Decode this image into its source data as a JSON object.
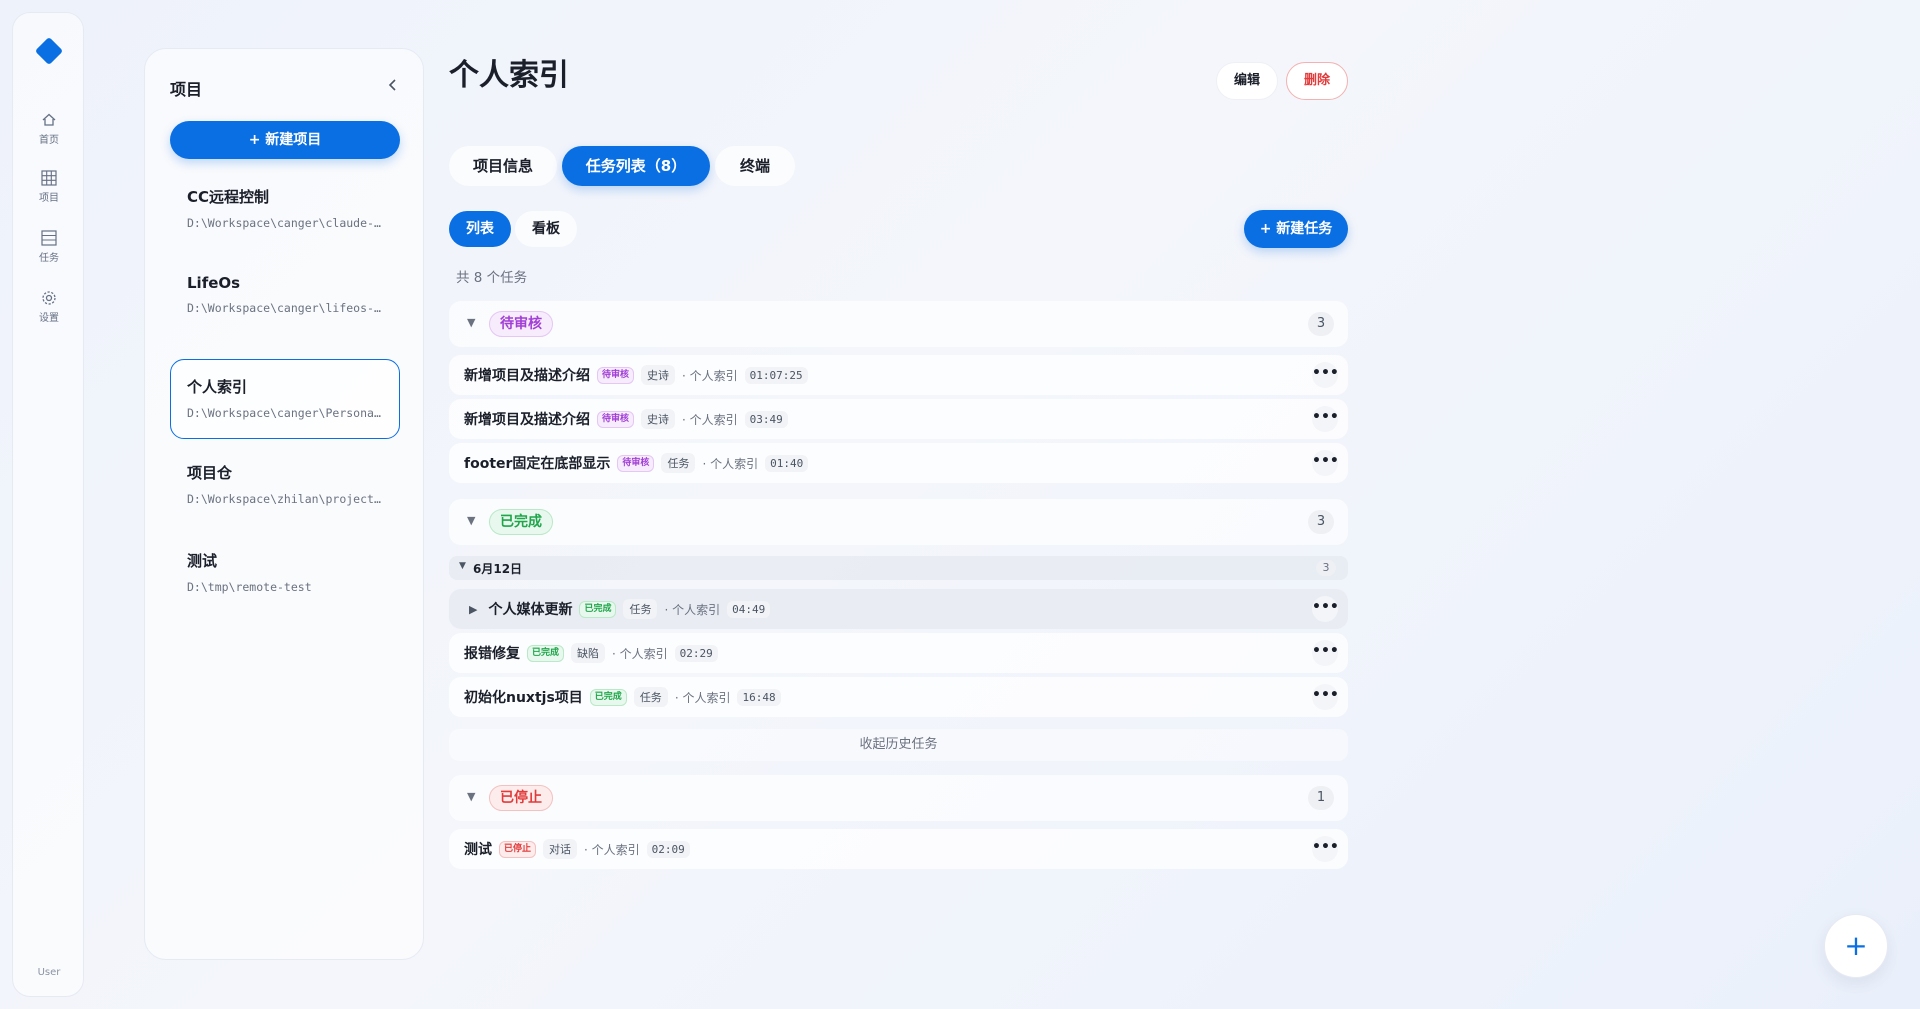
{
  "rail": {
    "items": [
      {
        "label": "首页",
        "icon": "home-icon"
      },
      {
        "label": "项目",
        "icon": "grid-icon"
      },
      {
        "label": "任务",
        "icon": "list-icon"
      },
      {
        "label": "设置",
        "icon": "gear-icon"
      }
    ],
    "user": "User"
  },
  "panel": {
    "title": "项目",
    "new_project": "+ 新建项目",
    "projects": [
      {
        "name": "CC远程控制",
        "path": "D:\\Workspace\\canger\\claude-code-remote"
      },
      {
        "name": "LifeOs",
        "path": "D:\\Workspace\\canger\\lifeos-project"
      },
      {
        "name": "个人索引",
        "path": "D:\\Workspace\\canger\\PersonalIndex"
      },
      {
        "name": "项目仓",
        "path": "D:\\Workspace\\zhilan\\project-hub"
      },
      {
        "name": "测试",
        "path": "D:\\tmp\\remote-test"
      }
    ]
  },
  "main": {
    "title": "个人索引",
    "edit": "编辑",
    "delete": "删除",
    "tabs": [
      {
        "label": "项目信息"
      },
      {
        "label": "任务列表（8）"
      },
      {
        "label": "终端"
      }
    ],
    "view": {
      "list": "列表",
      "board": "看板"
    },
    "new_task": "+ 新建任务",
    "count_text": "共 8 个任务",
    "groups": {
      "review": {
        "label": "待审核",
        "count": "3"
      },
      "done": {
        "label": "已完成",
        "count": "3"
      },
      "stopped": {
        "label": "已停止",
        "count": "1"
      }
    },
    "date_group": {
      "label": "6月12日",
      "count": "3"
    },
    "collapse_history": "收起历史任务",
    "tasks": [
      {
        "title": "新增项目及描述介绍",
        "badge": "待审核",
        "type": "史诗",
        "project": "· 个人索引",
        "time": "01:07:25"
      },
      {
        "title": "新增项目及描述介绍",
        "badge": "待审核",
        "type": "史诗",
        "project": "· 个人索引",
        "time": "03:49"
      },
      {
        "title": "footer固定在底部显示",
        "badge": "待审核",
        "type": "任务",
        "project": "· 个人索引",
        "time": "01:40"
      },
      {
        "title": "个人媒体更新",
        "badge": "已完成",
        "type": "任务",
        "project": "· 个人索引",
        "time": "04:49"
      },
      {
        "title": "报错修复",
        "badge": "已完成",
        "type": "缺陷",
        "project": "· 个人索引",
        "time": "02:29"
      },
      {
        "title": "初始化nuxtjs项目",
        "badge": "已完成",
        "type": "任务",
        "project": "· 个人索引",
        "time": "16:48"
      },
      {
        "title": "测试",
        "badge": "已停止",
        "type": "对话",
        "project": "· 个人索引",
        "time": "02:09"
      }
    ]
  },
  "colors": {
    "accent": "#0a6fe3",
    "review": "#a23fd6",
    "done": "#1fa64a",
    "stopped": "#e23b3b"
  }
}
